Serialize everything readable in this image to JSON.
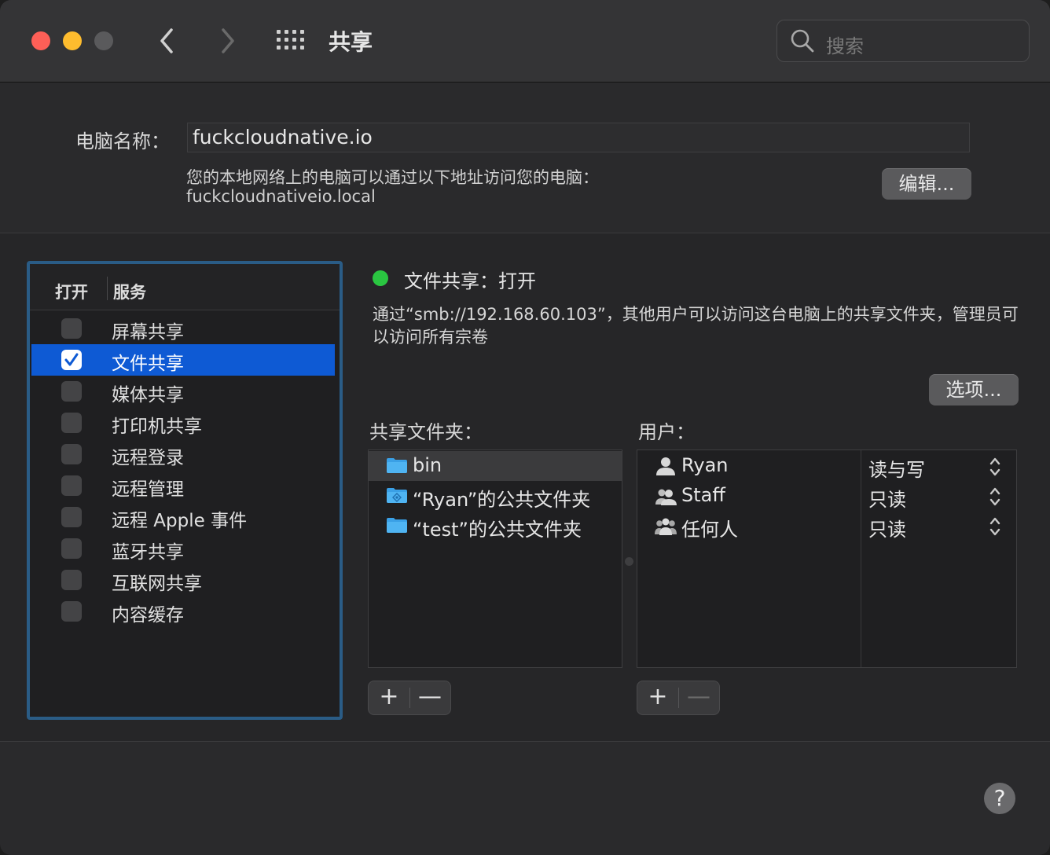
{
  "window": {
    "title": "共享",
    "search_placeholder": "搜索"
  },
  "computer": {
    "name_label": "电脑名称：",
    "name_value": "fuckcloudnative.io",
    "address_desc": "您的本地网络上的电脑可以通过以下地址访问您的电脑：",
    "address": "fuckcloudnativeio.local",
    "edit_button": "编辑..."
  },
  "services": {
    "header_on": "打开",
    "header_service": "服务",
    "items": [
      {
        "label": "屏幕共享",
        "checked": false
      },
      {
        "label": "文件共享",
        "checked": true,
        "selected": true
      },
      {
        "label": "媒体共享",
        "checked": false
      },
      {
        "label": "打印机共享",
        "checked": false
      },
      {
        "label": "远程登录",
        "checked": false
      },
      {
        "label": "远程管理",
        "checked": false
      },
      {
        "label": "远程 Apple 事件",
        "checked": false
      },
      {
        "label": "蓝牙共享",
        "checked": false
      },
      {
        "label": "互联网共享",
        "checked": false
      },
      {
        "label": "内容缓存",
        "checked": false
      }
    ]
  },
  "detail": {
    "status": "文件共享：打开",
    "status_color": "#2ac641",
    "description": "通过“smb://192.168.60.103”，其他用户可以访问这台电脑上的共享文件夹，管理员可以访问所有宗卷",
    "options_button": "选项...",
    "folders_label": "共享文件夹：",
    "users_label": "用户：",
    "folders": [
      {
        "label": "bin",
        "selected": true,
        "icon": "folder-icon"
      },
      {
        "label": "“Ryan”的公共文件夹",
        "icon": "public-folder-icon"
      },
      {
        "label": "“test”的公共文件夹",
        "icon": "folder-icon"
      }
    ],
    "users": [
      {
        "name": "Ryan",
        "permission": "读与写",
        "icon": "user-icon"
      },
      {
        "name": "Staff",
        "permission": "只读",
        "icon": "group-icon"
      },
      {
        "name": "任何人",
        "permission": "只读",
        "icon": "everyone-icon"
      }
    ],
    "add_symbol": "+",
    "remove_symbol": "—"
  },
  "help_symbol": "?",
  "colors": {
    "selection": "#0e5ad4",
    "focus_ring": "#2a5c86"
  }
}
